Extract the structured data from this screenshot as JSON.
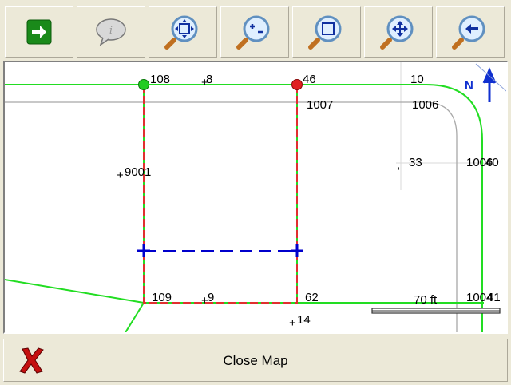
{
  "toolbar": {
    "buttons": [
      {
        "name": "forward-button",
        "icon": "arrow-right-icon"
      },
      {
        "name": "info-button",
        "icon": "speech-bubble-info-icon"
      },
      {
        "name": "zoom-extents-button",
        "icon": "zoom-extents-icon"
      },
      {
        "name": "zoom-in-out-button",
        "icon": "zoom-in-out-icon"
      },
      {
        "name": "zoom-window-button",
        "icon": "zoom-window-icon"
      },
      {
        "name": "pan-button",
        "icon": "pan-icon"
      },
      {
        "name": "previous-view-button",
        "icon": "previous-view-icon"
      }
    ]
  },
  "map": {
    "north_label": "N",
    "scale_label": "70 ft",
    "labels": {
      "l108": "108",
      "l8": "8",
      "l46": "46",
      "l10": "10",
      "l1007": "1007",
      "l1006": "1006",
      "l9001": "9001",
      "l33": "33",
      "l1006b": "1006",
      "l40": "40",
      "l109": "109",
      "l9": "9",
      "l62": "62",
      "l14": "14",
      "l1004": "1004",
      "l41": "41"
    },
    "colors": {
      "road": "#22dd22",
      "parcel": "#e03030",
      "measure": "#0000cc",
      "start_point": "#22cc22",
      "end_point": "#e02020"
    }
  },
  "bottom": {
    "close_label": "Close Map",
    "close_icon": "red-x-icon"
  }
}
